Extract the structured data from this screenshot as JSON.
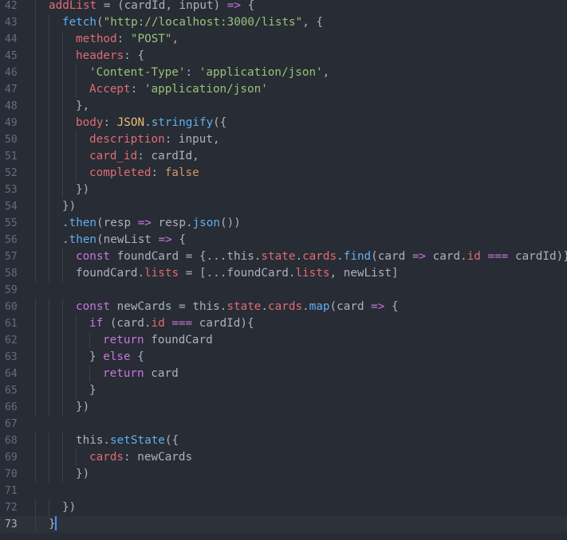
{
  "editor": {
    "cursor_line": 73,
    "lines": [
      {
        "n": "42",
        "indent": 1,
        "tokens": [
          {
            "t": "addList",
            "c": "t-var"
          },
          {
            "t": " = (cardId, input) ",
            "c": "t-plain"
          },
          {
            "t": "=>",
            "c": "t-op"
          },
          {
            "t": " {",
            "c": "t-plain"
          }
        ]
      },
      {
        "n": "43",
        "indent": 2,
        "tokens": [
          {
            "t": "fetch",
            "c": "t-fn"
          },
          {
            "t": "(",
            "c": "t-plain"
          },
          {
            "t": "\"http://localhost:3000/lists\"",
            "c": "t-str"
          },
          {
            "t": ", {",
            "c": "t-plain"
          }
        ]
      },
      {
        "n": "44",
        "indent": 3,
        "tokens": [
          {
            "t": "method",
            "c": "t-prop"
          },
          {
            "t": ": ",
            "c": "t-plain"
          },
          {
            "t": "\"POST\"",
            "c": "t-str"
          },
          {
            "t": ",",
            "c": "t-plain"
          }
        ]
      },
      {
        "n": "45",
        "indent": 3,
        "tokens": [
          {
            "t": "headers",
            "c": "t-prop"
          },
          {
            "t": ": {",
            "c": "t-plain"
          }
        ]
      },
      {
        "n": "46",
        "indent": 4,
        "tokens": [
          {
            "t": "'Content-Type'",
            "c": "t-str"
          },
          {
            "t": ": ",
            "c": "t-plain"
          },
          {
            "t": "'application/json'",
            "c": "t-str"
          },
          {
            "t": ",",
            "c": "t-plain"
          }
        ]
      },
      {
        "n": "47",
        "indent": 4,
        "tokens": [
          {
            "t": "Accept",
            "c": "t-prop"
          },
          {
            "t": ": ",
            "c": "t-plain"
          },
          {
            "t": "'application/json'",
            "c": "t-str"
          }
        ]
      },
      {
        "n": "48",
        "indent": 3,
        "tokens": [
          {
            "t": "},",
            "c": "t-plain"
          }
        ]
      },
      {
        "n": "49",
        "indent": 3,
        "tokens": [
          {
            "t": "body",
            "c": "t-prop"
          },
          {
            "t": ": ",
            "c": "t-plain"
          },
          {
            "t": "JSON",
            "c": "t-cls"
          },
          {
            "t": ".",
            "c": "t-plain"
          },
          {
            "t": "stringify",
            "c": "t-fn"
          },
          {
            "t": "({",
            "c": "t-plain"
          }
        ]
      },
      {
        "n": "50",
        "indent": 4,
        "tokens": [
          {
            "t": "description",
            "c": "t-prop"
          },
          {
            "t": ": input,",
            "c": "t-plain"
          }
        ]
      },
      {
        "n": "51",
        "indent": 4,
        "tokens": [
          {
            "t": "card_id",
            "c": "t-prop"
          },
          {
            "t": ": cardId,",
            "c": "t-plain"
          }
        ]
      },
      {
        "n": "52",
        "indent": 4,
        "tokens": [
          {
            "t": "completed",
            "c": "t-prop"
          },
          {
            "t": ": ",
            "c": "t-plain"
          },
          {
            "t": "false",
            "c": "t-num"
          }
        ]
      },
      {
        "n": "53",
        "indent": 3,
        "tokens": [
          {
            "t": "})",
            "c": "t-plain"
          }
        ]
      },
      {
        "n": "54",
        "indent": 2,
        "tokens": [
          {
            "t": "})",
            "c": "t-plain"
          }
        ]
      },
      {
        "n": "55",
        "indent": 2,
        "tokens": [
          {
            "t": ".",
            "c": "t-plain"
          },
          {
            "t": "then",
            "c": "t-fn"
          },
          {
            "t": "(resp ",
            "c": "t-plain"
          },
          {
            "t": "=>",
            "c": "t-op"
          },
          {
            "t": " resp.",
            "c": "t-plain"
          },
          {
            "t": "json",
            "c": "t-fn"
          },
          {
            "t": "())",
            "c": "t-plain"
          }
        ]
      },
      {
        "n": "56",
        "indent": 2,
        "tokens": [
          {
            "t": ".",
            "c": "t-plain"
          },
          {
            "t": "then",
            "c": "t-fn"
          },
          {
            "t": "(newList ",
            "c": "t-plain"
          },
          {
            "t": "=>",
            "c": "t-op"
          },
          {
            "t": " {",
            "c": "t-plain"
          }
        ]
      },
      {
        "n": "57",
        "indent": 3,
        "tokens": [
          {
            "t": "const",
            "c": "t-kw"
          },
          {
            "t": " foundCard = {...this.",
            "c": "t-plain"
          },
          {
            "t": "state",
            "c": "t-var"
          },
          {
            "t": ".",
            "c": "t-plain"
          },
          {
            "t": "cards",
            "c": "t-var"
          },
          {
            "t": ".",
            "c": "t-plain"
          },
          {
            "t": "find",
            "c": "t-fn"
          },
          {
            "t": "(card ",
            "c": "t-plain"
          },
          {
            "t": "=>",
            "c": "t-op"
          },
          {
            "t": " card.",
            "c": "t-plain"
          },
          {
            "t": "id",
            "c": "t-var"
          },
          {
            "t": " ",
            "c": "t-plain"
          },
          {
            "t": "===",
            "c": "t-op"
          },
          {
            "t": " cardId)}",
            "c": "t-plain"
          }
        ]
      },
      {
        "n": "58",
        "indent": 3,
        "tokens": [
          {
            "t": "foundCard.",
            "c": "t-plain"
          },
          {
            "t": "lists",
            "c": "t-var"
          },
          {
            "t": " = [...foundCard.",
            "c": "t-plain"
          },
          {
            "t": "lists",
            "c": "t-var"
          },
          {
            "t": ", newList]",
            "c": "t-plain"
          }
        ]
      },
      {
        "n": "59",
        "indent": 0,
        "tokens": []
      },
      {
        "n": "60",
        "indent": 3,
        "tokens": [
          {
            "t": "const",
            "c": "t-kw"
          },
          {
            "t": " newCards = this.",
            "c": "t-plain"
          },
          {
            "t": "state",
            "c": "t-var"
          },
          {
            "t": ".",
            "c": "t-plain"
          },
          {
            "t": "cards",
            "c": "t-var"
          },
          {
            "t": ".",
            "c": "t-plain"
          },
          {
            "t": "map",
            "c": "t-fn"
          },
          {
            "t": "(card ",
            "c": "t-plain"
          },
          {
            "t": "=>",
            "c": "t-op"
          },
          {
            "t": " {",
            "c": "t-plain"
          }
        ]
      },
      {
        "n": "61",
        "indent": 4,
        "tokens": [
          {
            "t": "if",
            "c": "t-kw"
          },
          {
            "t": " (card.",
            "c": "t-plain"
          },
          {
            "t": "id",
            "c": "t-var"
          },
          {
            "t": " ",
            "c": "t-plain"
          },
          {
            "t": "===",
            "c": "t-op"
          },
          {
            "t": " cardId){",
            "c": "t-plain"
          }
        ]
      },
      {
        "n": "62",
        "indent": 5,
        "tokens": [
          {
            "t": "return",
            "c": "t-kw"
          },
          {
            "t": " foundCard",
            "c": "t-plain"
          }
        ]
      },
      {
        "n": "63",
        "indent": 4,
        "tokens": [
          {
            "t": "} ",
            "c": "t-plain"
          },
          {
            "t": "else",
            "c": "t-kw"
          },
          {
            "t": " {",
            "c": "t-plain"
          }
        ]
      },
      {
        "n": "64",
        "indent": 5,
        "tokens": [
          {
            "t": "return",
            "c": "t-kw"
          },
          {
            "t": " card",
            "c": "t-plain"
          }
        ]
      },
      {
        "n": "65",
        "indent": 4,
        "tokens": [
          {
            "t": "}",
            "c": "t-plain"
          }
        ]
      },
      {
        "n": "66",
        "indent": 3,
        "tokens": [
          {
            "t": "})",
            "c": "t-plain"
          }
        ]
      },
      {
        "n": "67",
        "indent": 0,
        "tokens": []
      },
      {
        "n": "68",
        "indent": 3,
        "tokens": [
          {
            "t": "this.",
            "c": "t-plain"
          },
          {
            "t": "setState",
            "c": "t-fn"
          },
          {
            "t": "({",
            "c": "t-plain"
          }
        ]
      },
      {
        "n": "69",
        "indent": 4,
        "tokens": [
          {
            "t": "cards",
            "c": "t-prop"
          },
          {
            "t": ": newCards",
            "c": "t-plain"
          }
        ]
      },
      {
        "n": "70",
        "indent": 3,
        "tokens": [
          {
            "t": "})",
            "c": "t-plain"
          }
        ]
      },
      {
        "n": "71",
        "indent": 0,
        "tokens": []
      },
      {
        "n": "72",
        "indent": 2,
        "tokens": [
          {
            "t": "})",
            "c": "t-plain"
          }
        ]
      },
      {
        "n": "73",
        "indent": 1,
        "tokens": [
          {
            "t": "}",
            "c": "t-plain"
          }
        ]
      }
    ]
  }
}
